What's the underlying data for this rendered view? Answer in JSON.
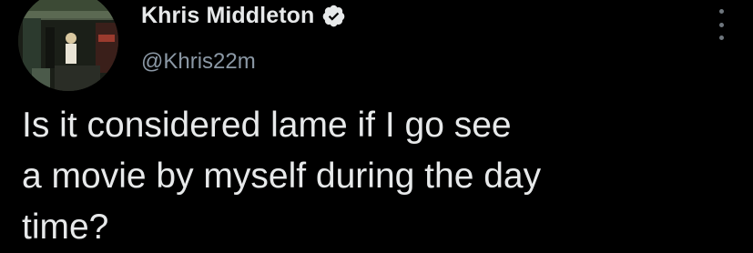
{
  "tweet": {
    "author": {
      "display_name": "Khris Middleton",
      "handle": "@Khris22m",
      "verified": true,
      "verified_icon": "verified-badge-icon"
    },
    "text": "Is it considered lame if I go see\na movie by myself during the day\ntime?",
    "more_icon": "more-options-icon"
  },
  "colors": {
    "background": "#000000",
    "text_primary": "#e7e9ea",
    "text_secondary": "#8b98a5",
    "more_dots": "#6e767d"
  }
}
